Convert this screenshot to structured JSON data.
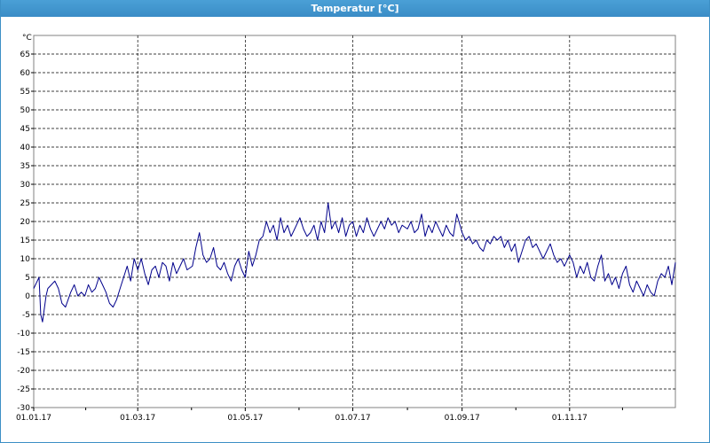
{
  "window": {
    "title": "Temperatur [°C]"
  },
  "chart_data": {
    "type": "line",
    "title": "Temperatur [°C]",
    "ylabel": "°C",
    "xlabel": "",
    "ylim": [
      -30,
      70
    ],
    "yticks": [
      -30,
      -25,
      -20,
      -15,
      -10,
      -5,
      0,
      5,
      10,
      15,
      20,
      25,
      30,
      35,
      40,
      45,
      50,
      55,
      60,
      65
    ],
    "x_start": "2017-01-01",
    "x_end": "2017-12-31",
    "xticks": [
      {
        "date": "2017-01-01",
        "label": "01.01.17"
      },
      {
        "date": "2017-03-01",
        "label": "01.03.17"
      },
      {
        "date": "2017-05-01",
        "label": "01.05.17"
      },
      {
        "date": "2017-07-01",
        "label": "01.07.17"
      },
      {
        "date": "2017-09-01",
        "label": "01.09.17"
      },
      {
        "date": "2017-11-01",
        "label": "01.11.17"
      }
    ],
    "grid": true,
    "colors": {
      "line": "#00008b",
      "grid": "#000000"
    },
    "series": [
      {
        "points": [
          [
            "2017-01-01",
            2
          ],
          [
            "2017-01-03",
            4
          ],
          [
            "2017-01-04",
            5
          ],
          [
            "2017-01-05",
            -5
          ],
          [
            "2017-01-06",
            -7
          ],
          [
            "2017-01-08",
            0
          ],
          [
            "2017-01-09",
            2
          ],
          [
            "2017-01-11",
            3
          ],
          [
            "2017-01-13",
            4
          ],
          [
            "2017-01-15",
            2
          ],
          [
            "2017-01-17",
            -2
          ],
          [
            "2017-01-19",
            -3
          ],
          [
            "2017-01-22",
            1
          ],
          [
            "2017-01-24",
            3
          ],
          [
            "2017-01-26",
            0
          ],
          [
            "2017-01-28",
            1
          ],
          [
            "2017-01-30",
            0
          ],
          [
            "2017-02-01",
            3
          ],
          [
            "2017-02-03",
            1
          ],
          [
            "2017-02-05",
            2
          ],
          [
            "2017-02-07",
            5
          ],
          [
            "2017-02-09",
            3
          ],
          [
            "2017-02-11",
            1
          ],
          [
            "2017-02-13",
            -2
          ],
          [
            "2017-02-15",
            -3
          ],
          [
            "2017-02-17",
            -1
          ],
          [
            "2017-02-19",
            2
          ],
          [
            "2017-02-21",
            5
          ],
          [
            "2017-02-23",
            8
          ],
          [
            "2017-02-25",
            4
          ],
          [
            "2017-02-27",
            10
          ],
          [
            "2017-03-01",
            7
          ],
          [
            "2017-03-03",
            10
          ],
          [
            "2017-03-05",
            6
          ],
          [
            "2017-03-07",
            3
          ],
          [
            "2017-03-09",
            7
          ],
          [
            "2017-03-11",
            8
          ],
          [
            "2017-03-13",
            5
          ],
          [
            "2017-03-15",
            9
          ],
          [
            "2017-03-17",
            8
          ],
          [
            "2017-03-19",
            4
          ],
          [
            "2017-03-21",
            9
          ],
          [
            "2017-03-23",
            6
          ],
          [
            "2017-03-25",
            8
          ],
          [
            "2017-03-27",
            10
          ],
          [
            "2017-03-29",
            7
          ],
          [
            "2017-04-01",
            8
          ],
          [
            "2017-04-03",
            13
          ],
          [
            "2017-04-05",
            17
          ],
          [
            "2017-04-07",
            11
          ],
          [
            "2017-04-09",
            9
          ],
          [
            "2017-04-11",
            10
          ],
          [
            "2017-04-13",
            13
          ],
          [
            "2017-04-15",
            8
          ],
          [
            "2017-04-17",
            7
          ],
          [
            "2017-04-19",
            9
          ],
          [
            "2017-04-21",
            6
          ],
          [
            "2017-04-23",
            4
          ],
          [
            "2017-04-25",
            8
          ],
          [
            "2017-04-27",
            10
          ],
          [
            "2017-04-29",
            7
          ],
          [
            "2017-05-01",
            5
          ],
          [
            "2017-05-03",
            12
          ],
          [
            "2017-05-05",
            8
          ],
          [
            "2017-05-07",
            11
          ],
          [
            "2017-05-09",
            15
          ],
          [
            "2017-05-11",
            16
          ],
          [
            "2017-05-13",
            20
          ],
          [
            "2017-05-15",
            17
          ],
          [
            "2017-05-17",
            19
          ],
          [
            "2017-05-19",
            15
          ],
          [
            "2017-05-21",
            21
          ],
          [
            "2017-05-23",
            17
          ],
          [
            "2017-05-25",
            19
          ],
          [
            "2017-05-27",
            16
          ],
          [
            "2017-05-29",
            18
          ],
          [
            "2017-06-01",
            21
          ],
          [
            "2017-06-03",
            18
          ],
          [
            "2017-06-05",
            16
          ],
          [
            "2017-06-07",
            17
          ],
          [
            "2017-06-09",
            19
          ],
          [
            "2017-06-11",
            15
          ],
          [
            "2017-06-13",
            20
          ],
          [
            "2017-06-15",
            17
          ],
          [
            "2017-06-17",
            25
          ],
          [
            "2017-06-19",
            18
          ],
          [
            "2017-06-21",
            20
          ],
          [
            "2017-06-23",
            17
          ],
          [
            "2017-06-25",
            21
          ],
          [
            "2017-06-27",
            16
          ],
          [
            "2017-06-29",
            19
          ],
          [
            "2017-07-01",
            20
          ],
          [
            "2017-07-03",
            16
          ],
          [
            "2017-07-05",
            19
          ],
          [
            "2017-07-07",
            17
          ],
          [
            "2017-07-09",
            21
          ],
          [
            "2017-07-11",
            18
          ],
          [
            "2017-07-13",
            16
          ],
          [
            "2017-07-15",
            18
          ],
          [
            "2017-07-17",
            20
          ],
          [
            "2017-07-19",
            18
          ],
          [
            "2017-07-21",
            21
          ],
          [
            "2017-07-23",
            19
          ],
          [
            "2017-07-25",
            20
          ],
          [
            "2017-07-27",
            17
          ],
          [
            "2017-07-29",
            19
          ],
          [
            "2017-08-01",
            18
          ],
          [
            "2017-08-03",
            20
          ],
          [
            "2017-08-05",
            17
          ],
          [
            "2017-08-07",
            18
          ],
          [
            "2017-08-09",
            22
          ],
          [
            "2017-08-11",
            16
          ],
          [
            "2017-08-13",
            19
          ],
          [
            "2017-08-15",
            17
          ],
          [
            "2017-08-17",
            20
          ],
          [
            "2017-08-19",
            18
          ],
          [
            "2017-08-21",
            16
          ],
          [
            "2017-08-23",
            19
          ],
          [
            "2017-08-25",
            17
          ],
          [
            "2017-08-27",
            16
          ],
          [
            "2017-08-29",
            22
          ],
          [
            "2017-09-01",
            17
          ],
          [
            "2017-09-03",
            15
          ],
          [
            "2017-09-05",
            16
          ],
          [
            "2017-09-07",
            14
          ],
          [
            "2017-09-09",
            15
          ],
          [
            "2017-09-11",
            13
          ],
          [
            "2017-09-13",
            12
          ],
          [
            "2017-09-15",
            15
          ],
          [
            "2017-09-17",
            14
          ],
          [
            "2017-09-19",
            16
          ],
          [
            "2017-09-21",
            15
          ],
          [
            "2017-09-23",
            16
          ],
          [
            "2017-09-25",
            13
          ],
          [
            "2017-09-27",
            15
          ],
          [
            "2017-09-29",
            12
          ],
          [
            "2017-10-01",
            14
          ],
          [
            "2017-10-03",
            9
          ],
          [
            "2017-10-05",
            12
          ],
          [
            "2017-10-07",
            15
          ],
          [
            "2017-10-09",
            16
          ],
          [
            "2017-10-11",
            13
          ],
          [
            "2017-10-13",
            14
          ],
          [
            "2017-10-15",
            12
          ],
          [
            "2017-10-17",
            10
          ],
          [
            "2017-10-19",
            12
          ],
          [
            "2017-10-21",
            14
          ],
          [
            "2017-10-23",
            11
          ],
          [
            "2017-10-25",
            9
          ],
          [
            "2017-10-27",
            10
          ],
          [
            "2017-10-29",
            8
          ],
          [
            "2017-11-01",
            11
          ],
          [
            "2017-11-03",
            9
          ],
          [
            "2017-11-05",
            5
          ],
          [
            "2017-11-07",
            8
          ],
          [
            "2017-11-09",
            6
          ],
          [
            "2017-11-11",
            9
          ],
          [
            "2017-11-13",
            5
          ],
          [
            "2017-11-15",
            4
          ],
          [
            "2017-11-17",
            8
          ],
          [
            "2017-11-19",
            11
          ],
          [
            "2017-11-21",
            4
          ],
          [
            "2017-11-23",
            6
          ],
          [
            "2017-11-25",
            3
          ],
          [
            "2017-11-27",
            5
          ],
          [
            "2017-11-29",
            2
          ],
          [
            "2017-12-01",
            6
          ],
          [
            "2017-12-03",
            8
          ],
          [
            "2017-12-05",
            3
          ],
          [
            "2017-12-07",
            1
          ],
          [
            "2017-12-09",
            4
          ],
          [
            "2017-12-11",
            2
          ],
          [
            "2017-12-13",
            0
          ],
          [
            "2017-12-15",
            3
          ],
          [
            "2017-12-17",
            1
          ],
          [
            "2017-12-19",
            0
          ],
          [
            "2017-12-21",
            4
          ],
          [
            "2017-12-23",
            6
          ],
          [
            "2017-12-25",
            5
          ],
          [
            "2017-12-27",
            8
          ],
          [
            "2017-12-29",
            3
          ],
          [
            "2017-12-31",
            9
          ]
        ]
      }
    ]
  }
}
